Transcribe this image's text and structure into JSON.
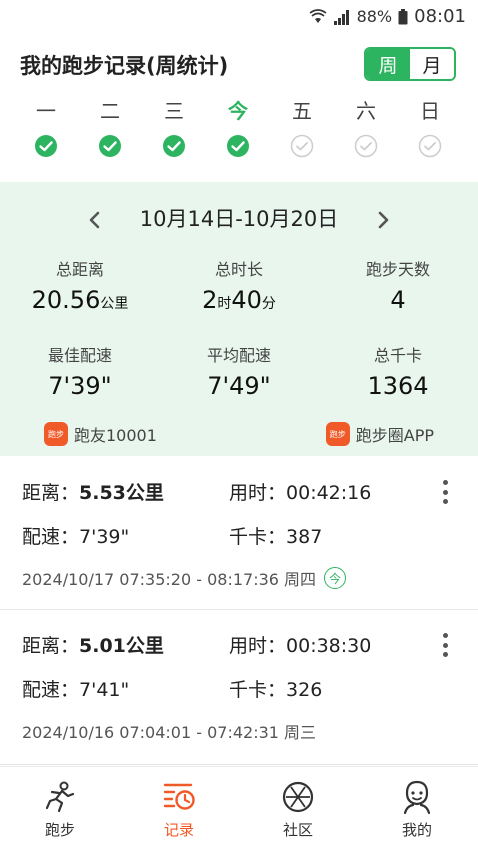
{
  "status_bar": {
    "battery": "88%",
    "time": "08:01"
  },
  "header": {
    "title": "我的跑步记录(周统计)",
    "toggle": {
      "week": "周",
      "month": "月"
    }
  },
  "week_days": [
    {
      "label": "一",
      "done": true
    },
    {
      "label": "二",
      "done": true
    },
    {
      "label": "三",
      "done": true
    },
    {
      "label": "今",
      "done": true,
      "today": true
    },
    {
      "label": "五",
      "done": false
    },
    {
      "label": "六",
      "done": false
    },
    {
      "label": "日",
      "done": false
    }
  ],
  "summary": {
    "range": "10月14日-10月20日",
    "total_distance": {
      "label": "总距离",
      "value": "20.56",
      "unit": "公里"
    },
    "total_time": {
      "label": "总时长",
      "hours": "2",
      "hours_unit": "时",
      "minutes": "40",
      "minutes_unit": "分"
    },
    "run_days": {
      "label": "跑步天数",
      "value": "4"
    },
    "best_pace": {
      "label": "最佳配速",
      "value": "7'39\""
    },
    "avg_pace": {
      "label": "平均配速",
      "value": "7'49\""
    },
    "total_kcal": {
      "label": "总千卡",
      "value": "1364"
    },
    "user": "跑友10001",
    "app": "跑步圈APP",
    "logo_text": "跑步"
  },
  "records": [
    {
      "distance_label": "距离：",
      "distance": "5.53公里",
      "time_label": "用时：",
      "time": "00:42:16",
      "pace_label": "配速：",
      "pace": "7'39\"",
      "kcal_label": "千卡：",
      "kcal": "387",
      "datetime": "2024/10/17  07:35:20 - 08:17:36  周四",
      "badge": "今"
    },
    {
      "distance_label": "距离：",
      "distance": "5.01公里",
      "time_label": "用时：",
      "time": "00:38:30",
      "pace_label": "配速：",
      "pace": "7'41\"",
      "kcal_label": "千卡：",
      "kcal": "326",
      "datetime": "2024/10/16  07:04:01 - 07:42:31  周三"
    }
  ],
  "nav": [
    {
      "label": "跑步",
      "icon": "runner-icon"
    },
    {
      "label": "记录",
      "icon": "record-icon",
      "active": true
    },
    {
      "label": "社区",
      "icon": "community-icon"
    },
    {
      "label": "我的",
      "icon": "profile-icon"
    }
  ],
  "colors": {
    "accent": "#2db461",
    "summary_bg": "#e8f6ee",
    "brand": "#f05a28",
    "inactive_check": "#cccccc"
  }
}
